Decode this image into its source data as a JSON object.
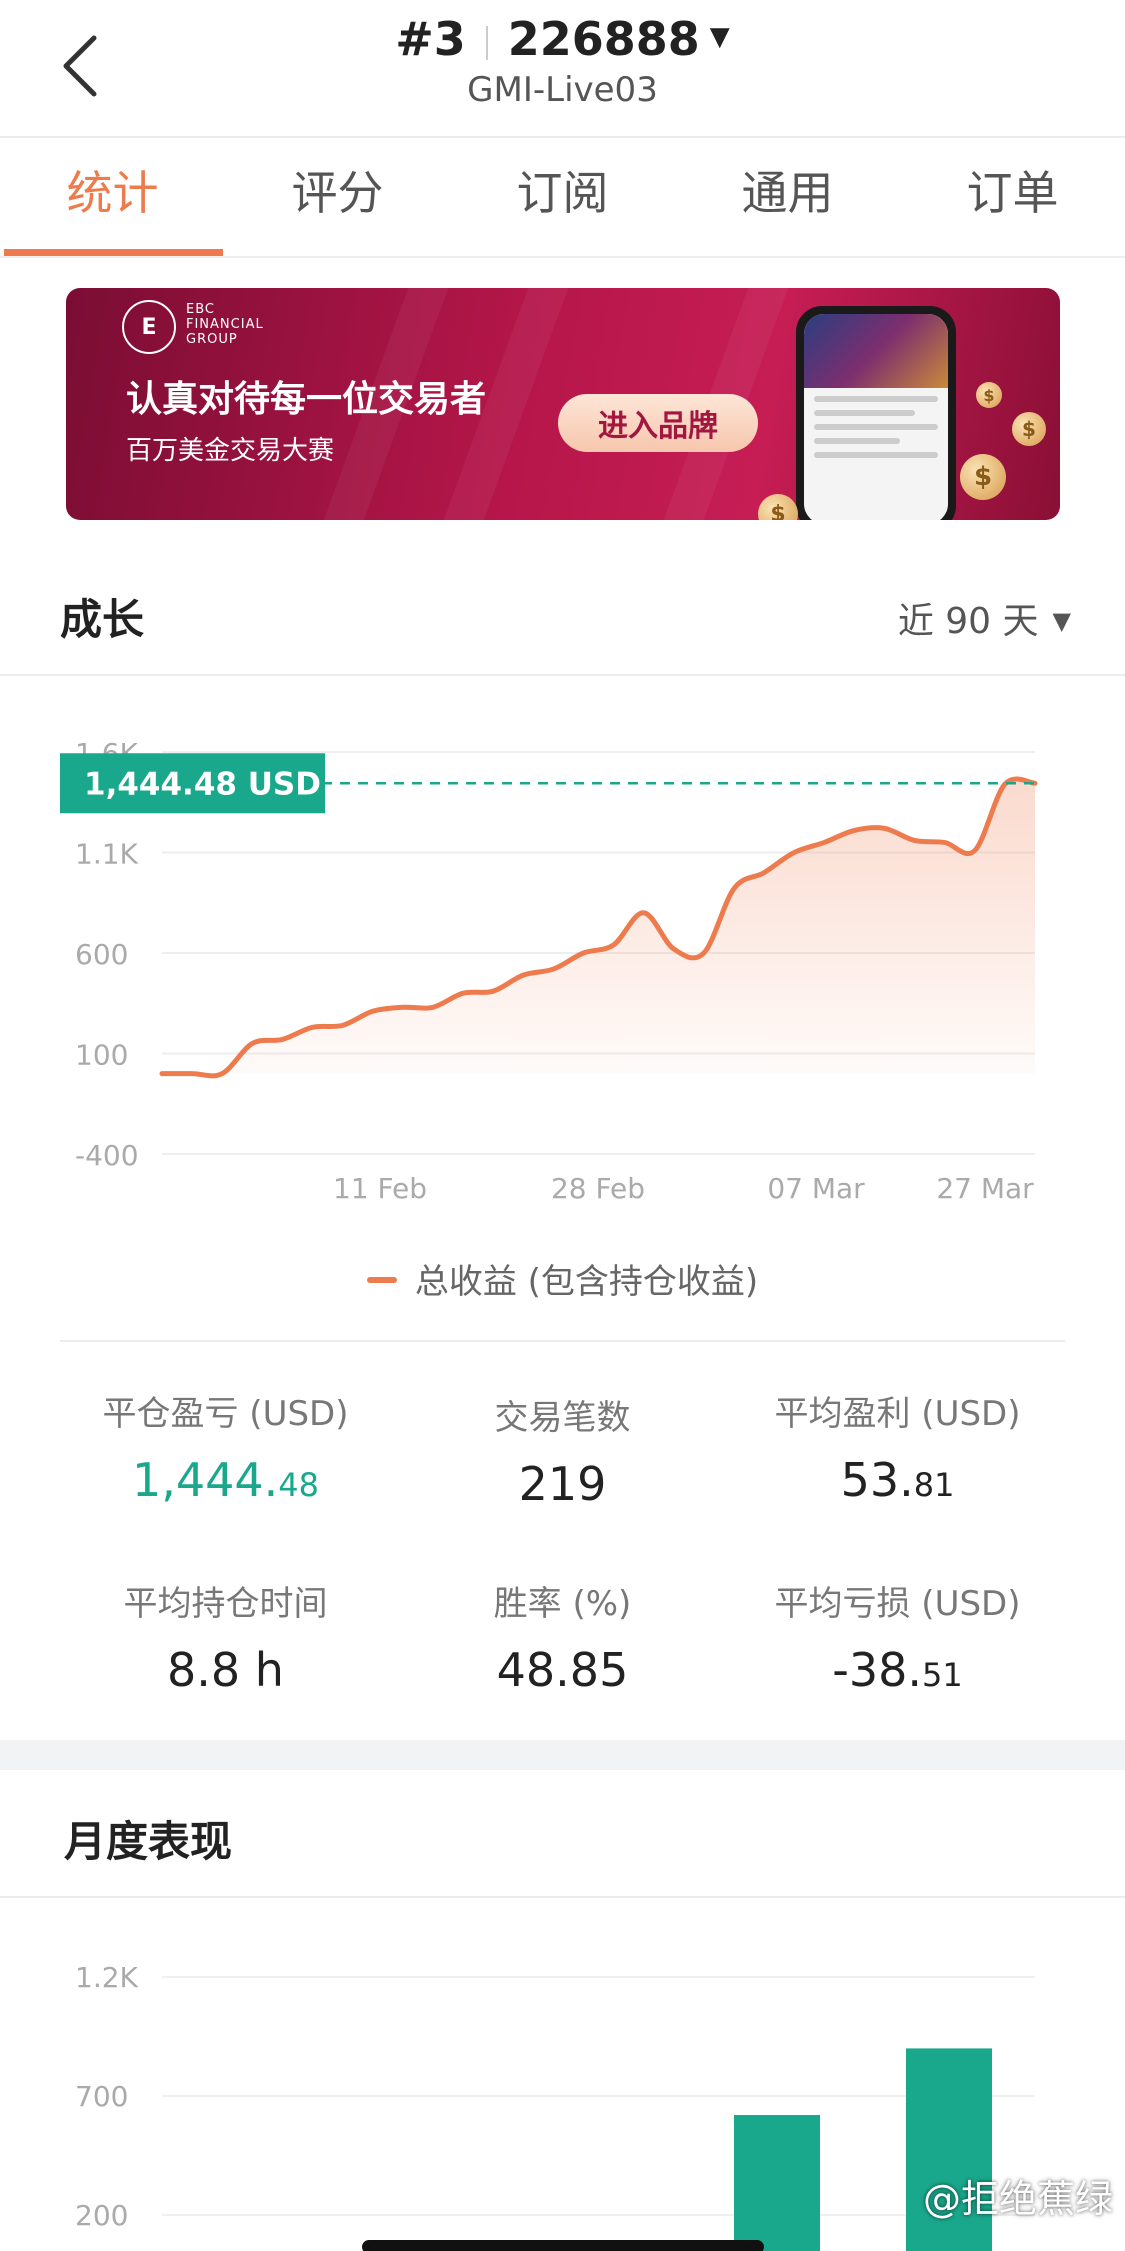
{
  "header": {
    "rank": "#3",
    "account": "226888",
    "server": "GMI-Live03"
  },
  "tabs": [
    "统计",
    "评分",
    "订阅",
    "通用",
    "订单"
  ],
  "banner": {
    "brand_lines": [
      "EBC",
      "FINANCIAL",
      "GROUP"
    ],
    "headline": "认真对待每一位交易者",
    "subtitle": "百万美金交易大赛",
    "button": "进入品牌"
  },
  "growth": {
    "title": "成长",
    "range": "近 90 天",
    "current_label": "1,444.48 USD",
    "legend": "总收益 (包含持仓收益)"
  },
  "chart_data": [
    {
      "type": "area",
      "y_ticks": [
        "1.6K",
        "1.1K",
        "600",
        "100",
        "-400"
      ],
      "x_ticks": [
        "11 Feb",
        "28 Feb",
        "07 Mar",
        "27 Mar"
      ],
      "ylim": [
        -400,
        1600
      ],
      "series": [
        {
          "name": "总收益 (包含持仓收益)",
          "color": "#ee7b4d",
          "values": [
            0,
            0,
            0,
            150,
            170,
            230,
            240,
            310,
            330,
            330,
            400,
            410,
            490,
            520,
            600,
            640,
            800,
            620,
            600,
            920,
            1000,
            1100,
            1150,
            1210,
            1220,
            1160,
            1150,
            1110,
            1440,
            1444.48
          ]
        }
      ],
      "reference_line": 1444.48,
      "grid": true
    },
    {
      "type": "bar",
      "y_ticks": [
        "1.2K",
        "700",
        "200"
      ],
      "series": [
        {
          "color": "#1aa88c",
          "values": [
            620,
            900
          ]
        }
      ]
    }
  ],
  "stats": [
    {
      "label": "平仓盈亏 (USD)",
      "int": "1,444.",
      "dec": "48",
      "green": true
    },
    {
      "label": "交易笔数",
      "int": "219",
      "dec": "",
      "green": false
    },
    {
      "label": "平均盈利 (USD)",
      "int": "53.",
      "dec": "81",
      "green": false
    },
    {
      "label": "平均持仓时间",
      "int": "8.8 h",
      "dec": "",
      "green": false
    },
    {
      "label": "胜率 (%)",
      "int": "48.85",
      "dec": "",
      "green": false
    },
    {
      "label": "平均亏损 (USD)",
      "int": "-38.",
      "dec": "51",
      "green": false
    }
  ],
  "monthly": {
    "title": "月度表现"
  },
  "watermark": "@拒绝蕉绿",
  "colors": {
    "accent": "#ee7b4d",
    "positive": "#1aa88c",
    "banner": "#b5164a"
  }
}
